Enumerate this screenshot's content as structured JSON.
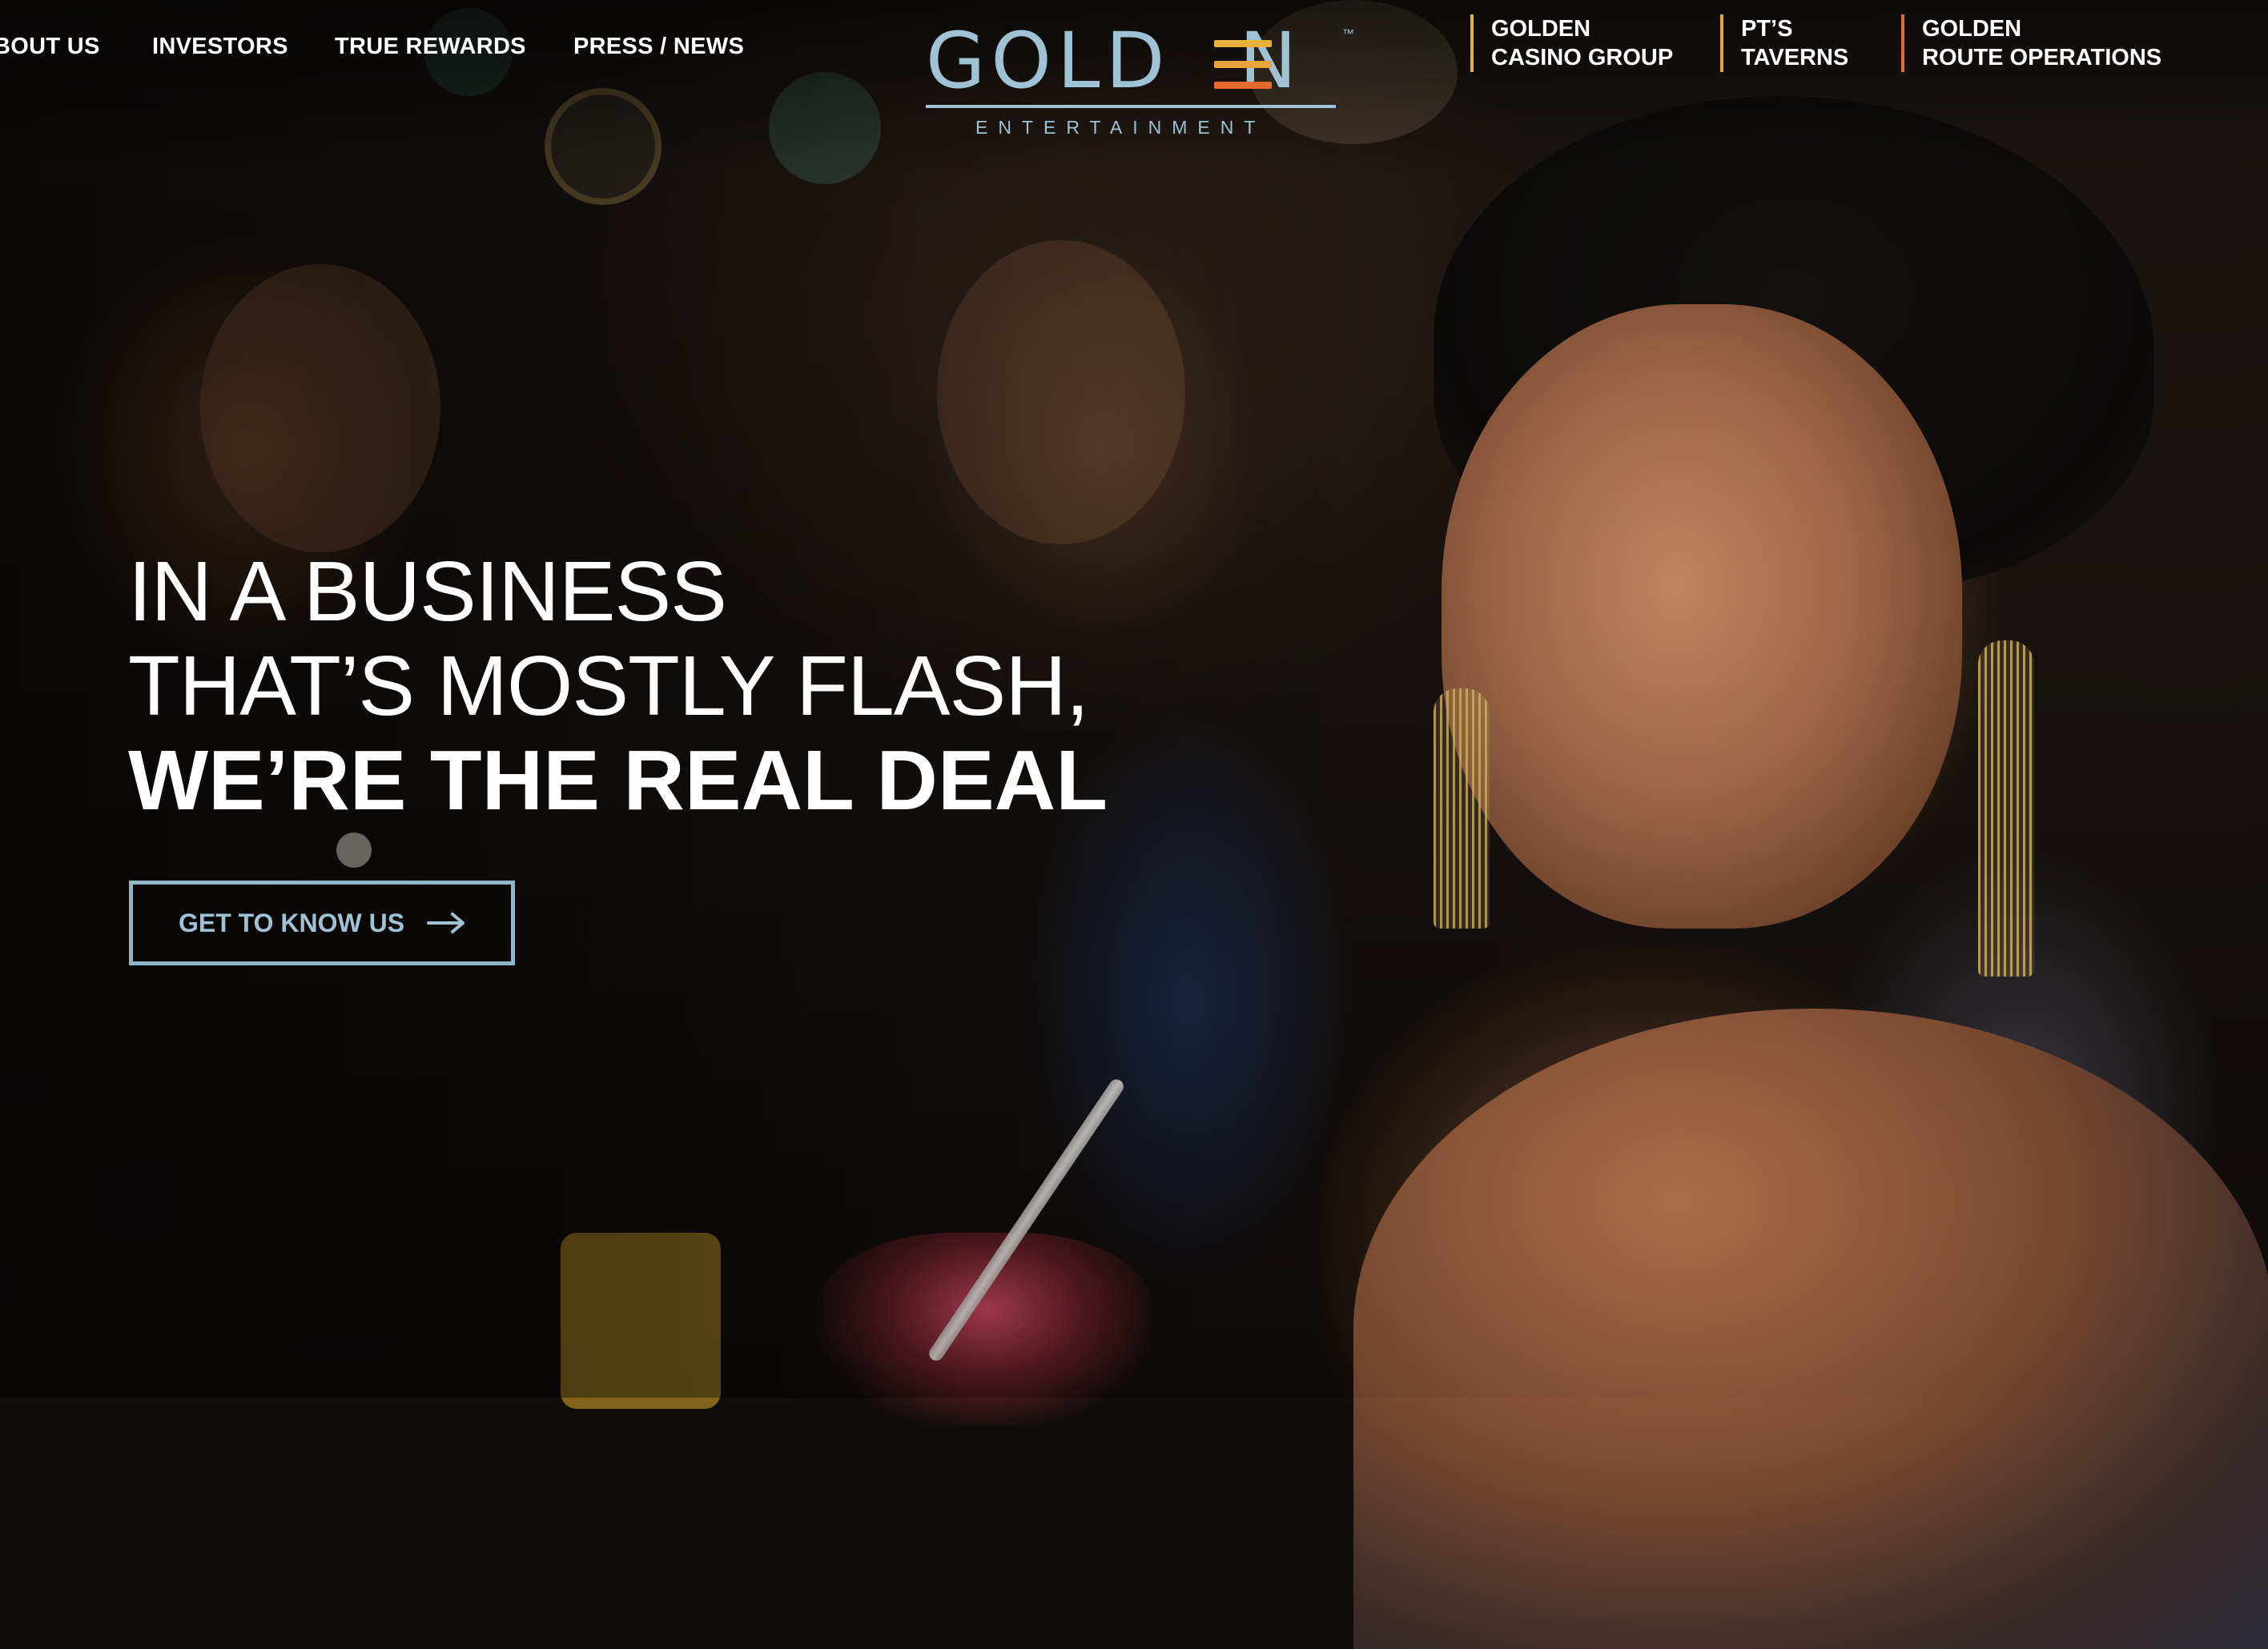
{
  "nav": {
    "items": [
      {
        "label": "BOUT US"
      },
      {
        "label": "INVESTORS"
      },
      {
        "label": "TRUE REWARDS"
      },
      {
        "label": "PRESS / NEWS"
      }
    ]
  },
  "logo": {
    "word": "GOLD",
    "word_end": "N",
    "trademark": "™",
    "subtitle": "ENTERTAINMENT"
  },
  "brands": [
    {
      "line1": "GOLDEN",
      "line2": "CASINO GROUP",
      "accent": "#e8b13c"
    },
    {
      "line1": "PT’S",
      "line2": "TAVERNS",
      "accent": "#e8a43c"
    },
    {
      "line1": "GOLDEN",
      "line2": "ROUTE OPERATIONS",
      "accent": "#e46a2e"
    }
  ],
  "hero": {
    "line1": "IN A BUSINESS",
    "line2": "THAT’S MOSTLY FLASH,",
    "line3": "WE’RE THE REAL DEAL",
    "cta_label": "GET TO KNOW US",
    "cta_icon": "arrow-right-icon"
  },
  "colors": {
    "logo_blue": "#9fc3d4",
    "logo_e_top": "#e8b13c",
    "logo_e_mid": "#e8a43c",
    "logo_e_bottom": "#e46a2e",
    "text": "#ffffff"
  }
}
